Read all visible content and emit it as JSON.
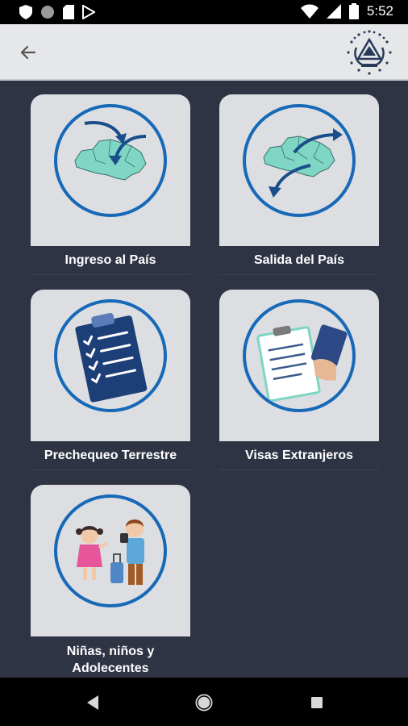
{
  "status_bar": {
    "time": "5:52",
    "left_icons": [
      "shield-icon",
      "circle-icon",
      "sd-card-icon",
      "play-store-icon"
    ],
    "right_icons": [
      "wifi-icon",
      "signal-icon",
      "battery-icon"
    ]
  },
  "app_bar": {
    "back_icon": "arrow-left-icon",
    "emblem": "el-salvador-coat-of-arms-icon"
  },
  "cards": [
    {
      "label": "Ingreso al País",
      "icon": "map-arrows-in-icon"
    },
    {
      "label": "Salida del País",
      "icon": "map-arrows-out-icon"
    },
    {
      "label": "Prechequeo Terrestre",
      "icon": "clipboard-checklist-icon"
    },
    {
      "label": "Visas Extranjeros",
      "icon": "visa-card-icon"
    },
    {
      "label": "Niñas, niños y\nAdolecentes",
      "label_line1": "Niñas, niños y",
      "label_line2": "Adolecentes",
      "icon": "children-travel-icon"
    }
  ],
  "colors": {
    "background": "#2f3445",
    "card": "#dcdee2",
    "ring": "#1769b8",
    "map": "#7fd6c4",
    "arrow": "#1a4e8a"
  },
  "nav_bar": {
    "icons": [
      "back-triangle-icon",
      "home-circle-icon",
      "recents-square-icon"
    ]
  }
}
